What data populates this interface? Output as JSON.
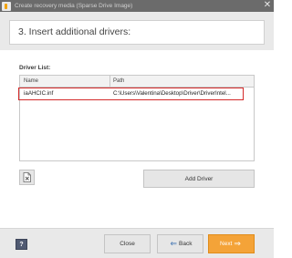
{
  "window": {
    "title": "Create recovery media (Sparse Drive Image)",
    "close_glyph": "✕"
  },
  "step": {
    "title": "3. Insert additional drivers:"
  },
  "driver_list": {
    "label": "Driver List:",
    "columns": [
      "Name",
      "Path"
    ],
    "rows": [
      {
        "name": "iaAHCIC.inf",
        "path": "C:\\Users\\Valentina\\Desktop\\Driver\\DriverIntel..."
      }
    ]
  },
  "buttons": {
    "add_driver": "Add Driver",
    "help": "?",
    "close": "Close",
    "back": "Back",
    "next": "Next"
  },
  "icons": {
    "remove": "×",
    "back_arrow": "⇐",
    "next_arrow": "⇒"
  },
  "colors": {
    "accent": "#f4a338",
    "highlight": "#d42a2a"
  }
}
